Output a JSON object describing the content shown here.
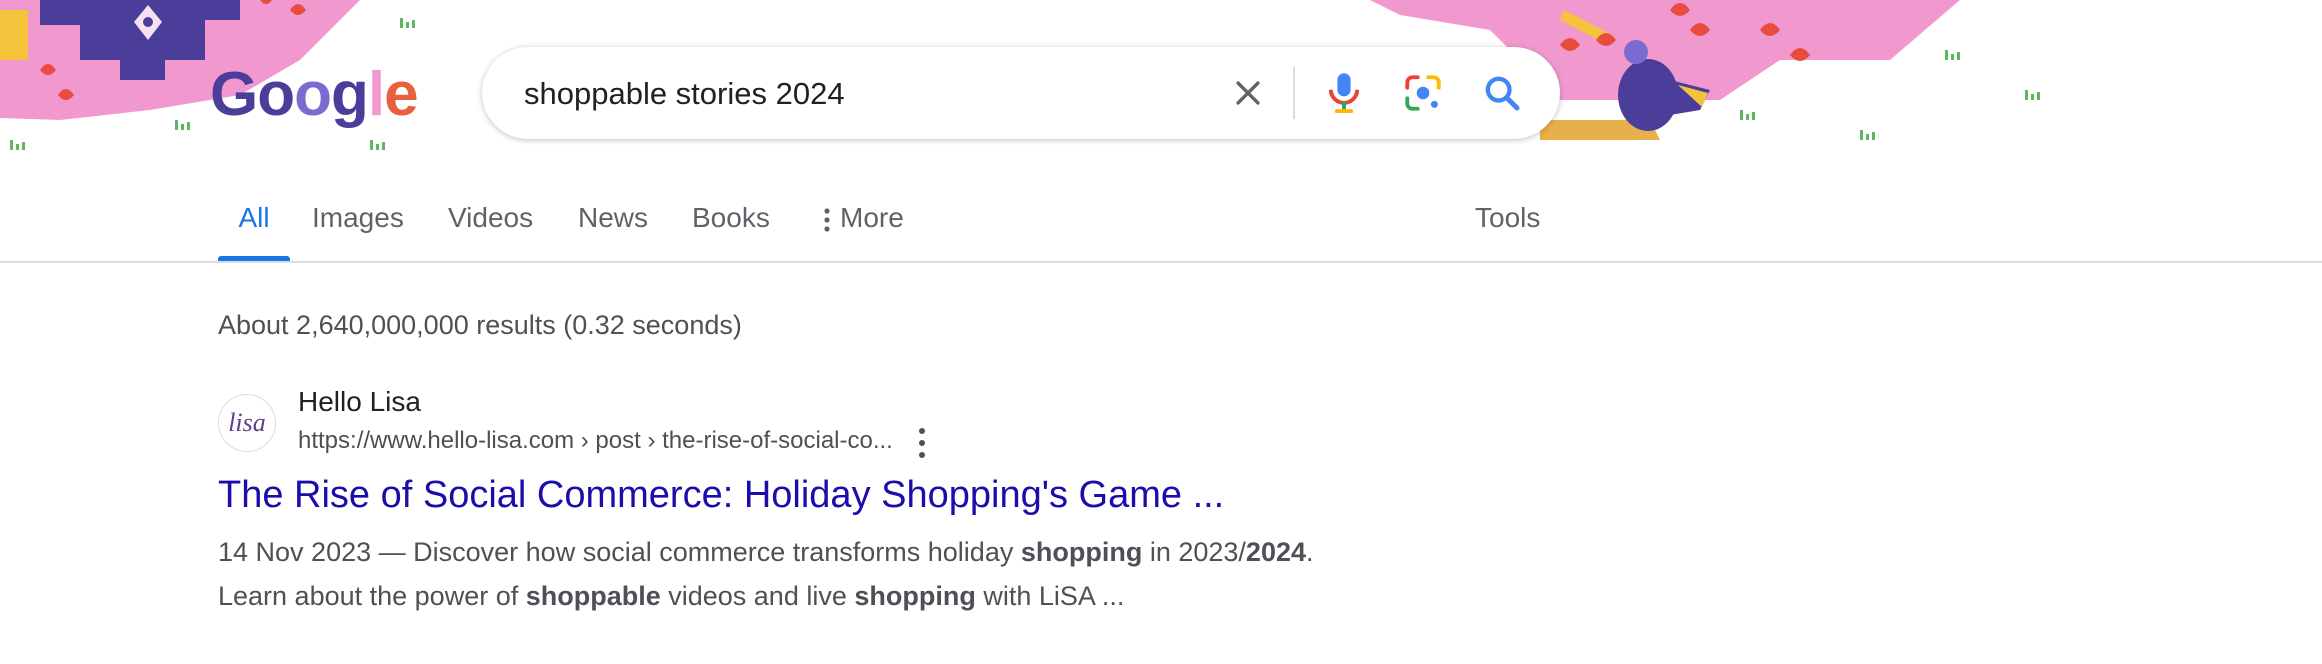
{
  "logo": {
    "text": "Google"
  },
  "search": {
    "query": "shoppable stories 2024"
  },
  "icons": {
    "clear": "close-icon",
    "voice": "microphone-icon",
    "lens": "camera-lens-icon",
    "search": "search-icon",
    "more": "vertical-dots-icon"
  },
  "tabs": [
    {
      "label": "All"
    },
    {
      "label": "Images"
    },
    {
      "label": "Videos"
    },
    {
      "label": "News"
    },
    {
      "label": "Books"
    },
    {
      "label": "More"
    }
  ],
  "tools_label": "Tools",
  "stats": "About 2,640,000,000 results (0.32 seconds)",
  "results": [
    {
      "favicon_text": "lisa",
      "site_name": "Hello Lisa",
      "url": "https://www.hello-lisa.com › post › the-rise-of-social-co...",
      "title": "The Rise of Social Commerce: Holiday Shopping's Game ...",
      "snippet": {
        "date": "14 Nov 2023",
        "sep": " — ",
        "t1": "Discover how social commerce transforms holiday ",
        "b1": "shopping",
        "t2": " in 2023/",
        "b2": "2024",
        "t3": ".",
        "t4": "Learn about the power of ",
        "b3": "shoppable",
        "t5": " videos and live ",
        "b4": "shopping",
        "t6": " with LiSA ..."
      }
    }
  ],
  "colors": {
    "accent": "#1a73e8",
    "link": "#1a0dab",
    "doodle_pink": "#f199cf",
    "doodle_purple": "#4a3e9a"
  }
}
